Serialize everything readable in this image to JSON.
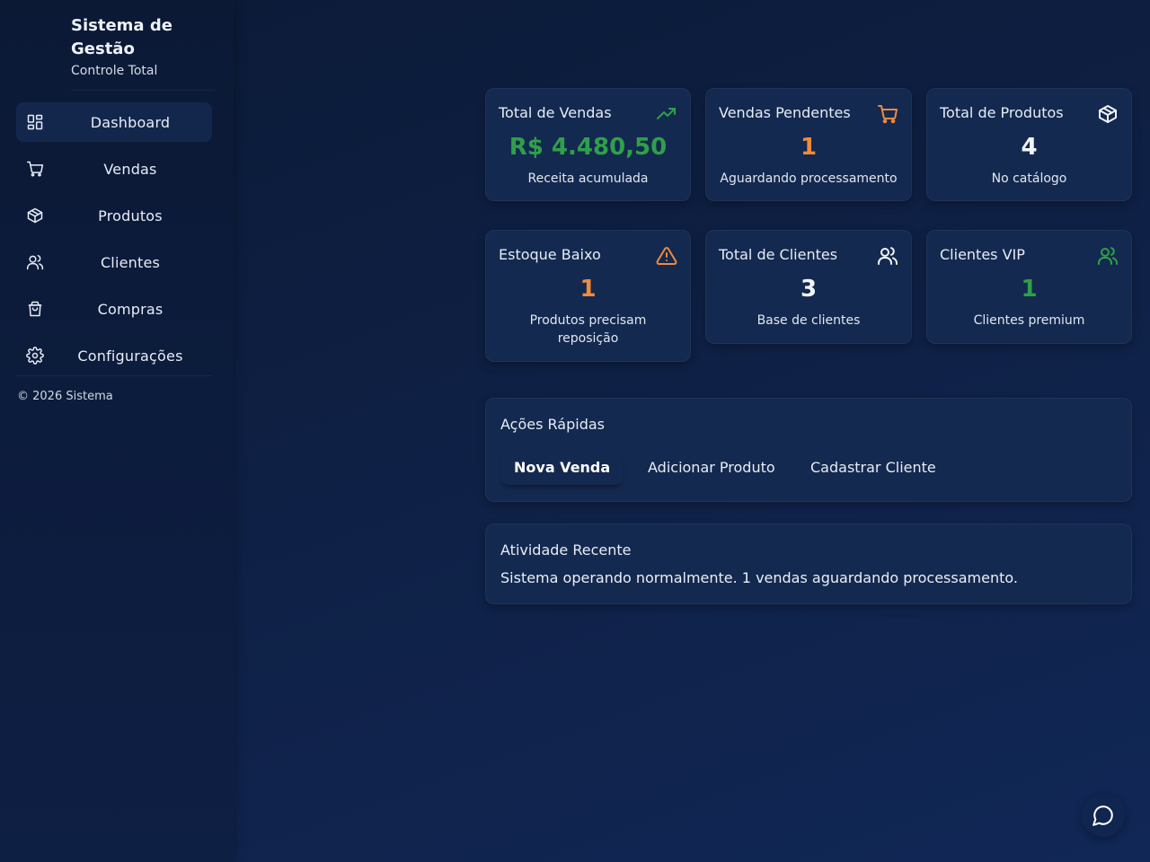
{
  "brand": {
    "title": "Sistema de Gestão",
    "subtitle": "Controle Total"
  },
  "sidebar": {
    "items": [
      {
        "label": "Dashboard",
        "icon": "dashboard-icon",
        "active": true
      },
      {
        "label": "Vendas",
        "icon": "cart-icon"
      },
      {
        "label": "Produtos",
        "icon": "package-icon"
      },
      {
        "label": "Clientes",
        "icon": "users-icon"
      },
      {
        "label": "Compras",
        "icon": "shopping-bag-icon"
      },
      {
        "label": "Configurações",
        "icon": "gear-icon"
      }
    ],
    "footer": "© 2026 Sistema"
  },
  "stats": [
    {
      "title": "Total de Vendas",
      "value": "R$ 4.480,50",
      "desc": "Receita acumulada",
      "icon": "trending-up-icon",
      "color": "#2fa04a"
    },
    {
      "title": "Vendas Pendentes",
      "value": "1",
      "desc": "Aguardando processamento",
      "icon": "cart-icon",
      "color": "#ef8b3c"
    },
    {
      "title": "Total de Produtos",
      "value": "4",
      "desc": "No catálogo",
      "icon": "package-icon",
      "color": "#f1f4fa"
    },
    {
      "title": "Estoque Baixo",
      "value": "1",
      "desc": "Produtos precisam reposição",
      "icon": "warning-icon",
      "color": "#ef8b3c"
    },
    {
      "title": "Total de Clientes",
      "value": "3",
      "desc": "Base de clientes",
      "icon": "users-icon",
      "color": "#f1f4fa"
    },
    {
      "title": "Clientes VIP",
      "value": "1",
      "desc": "Clientes premium",
      "icon": "users-icon",
      "color": "#2fa04a"
    }
  ],
  "quick_actions": {
    "title": "Ações Rápidas",
    "buttons": [
      "Nova Venda",
      "Adicionar Produto",
      "Cadastrar Cliente"
    ]
  },
  "activity": {
    "title": "Atividade Recente",
    "text": "Sistema operando normalmente. 1 vendas aguardando processamento."
  },
  "colors": {
    "accent_green": "#2fa04a",
    "accent_orange": "#ef8b3c",
    "background": "#0f2147"
  }
}
